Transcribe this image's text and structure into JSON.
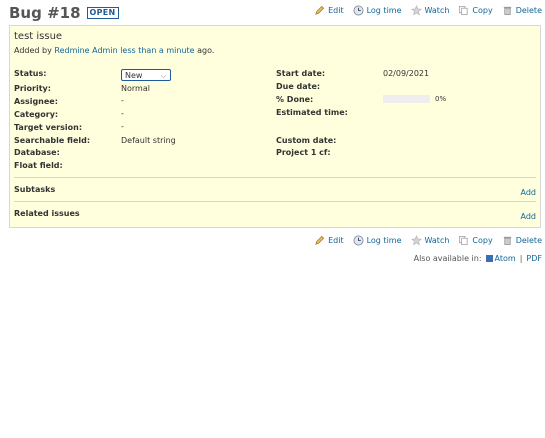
{
  "issue": {
    "title": "Bug #18",
    "status_badge": "OPEN",
    "subject": "test issue",
    "author_prefix": "Added by",
    "author": "Redmine Admin",
    "time_ago": "less than a minute",
    "author_suffix": "ago."
  },
  "actions": {
    "edit": "Edit",
    "log_time": "Log time",
    "watch": "Watch",
    "copy": "Copy",
    "delete": "Delete"
  },
  "attributes": {
    "status_label": "Status:",
    "status_value": "New",
    "priority_label": "Priority:",
    "priority_value": "Normal",
    "assignee_label": "Assignee:",
    "assignee_value": "-",
    "category_label": "Category:",
    "category_value": "-",
    "target_version_label": "Target version:",
    "target_version_value": "-",
    "searchable_field_label": "Searchable field:",
    "searchable_field_value": "Default string",
    "database_label": "Database:",
    "float_field_label": "Float field:",
    "start_date_label": "Start date:",
    "start_date_value": "02/09/2021",
    "due_date_label": "Due date:",
    "done_label": "% Done:",
    "done_value": "0%",
    "done_fraction": 0,
    "estimated_time_label": "Estimated time:",
    "custom_date_label": "Custom date:",
    "project_cf_label": "Project 1 cf:"
  },
  "sections": {
    "subtasks_label": "Subtasks",
    "subtasks_add": "Add",
    "related_label": "Related issues",
    "related_add": "Add"
  },
  "footer": {
    "also_available": "Also available in:",
    "atom": "Atom",
    "separator": "|",
    "pdf": "PDF"
  },
  "colors": {
    "box_background": "#ffffdd",
    "link": "#116699",
    "badge": "#1d5b9a"
  }
}
